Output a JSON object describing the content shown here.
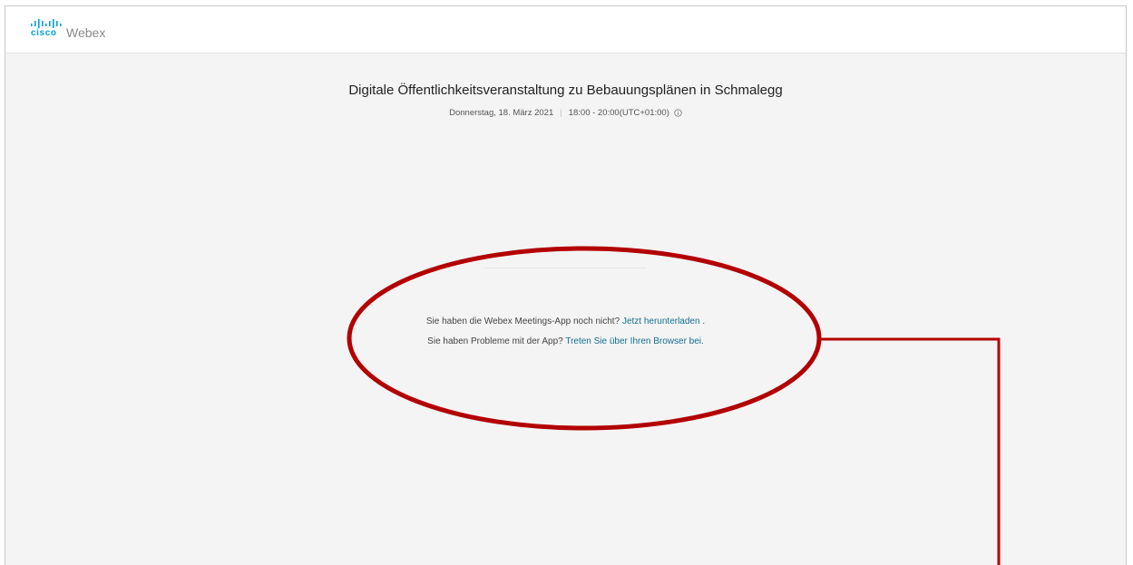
{
  "header": {
    "logo": {
      "brand": "cisco",
      "product": "Webex",
      "icon": "cisco-bars-icon",
      "brand_color": "#049fd9"
    }
  },
  "meeting": {
    "title": "Digitale Öffentlichkeitsveranstaltung zu Bebauungsplänen in Schmalegg",
    "date": "Donnerstag, 18. März 2021",
    "separator": "|",
    "time": "18:00 - 20:00(UTC+01:00)",
    "info_icon": "info-icon"
  },
  "join": {
    "line1_text": "Sie haben die Webex Meetings-App noch nicht?",
    "line1_link": "Jetzt herunterladen",
    "line1_suffix": ".",
    "line2_text": "Sie haben Probleme mit der App?",
    "line2_link": "Treten Sie über Ihren Browser bei.",
    "link_color": "#12708f"
  },
  "annotation": {
    "color": "#b30000",
    "shape": "ellipse-with-callout-line"
  }
}
